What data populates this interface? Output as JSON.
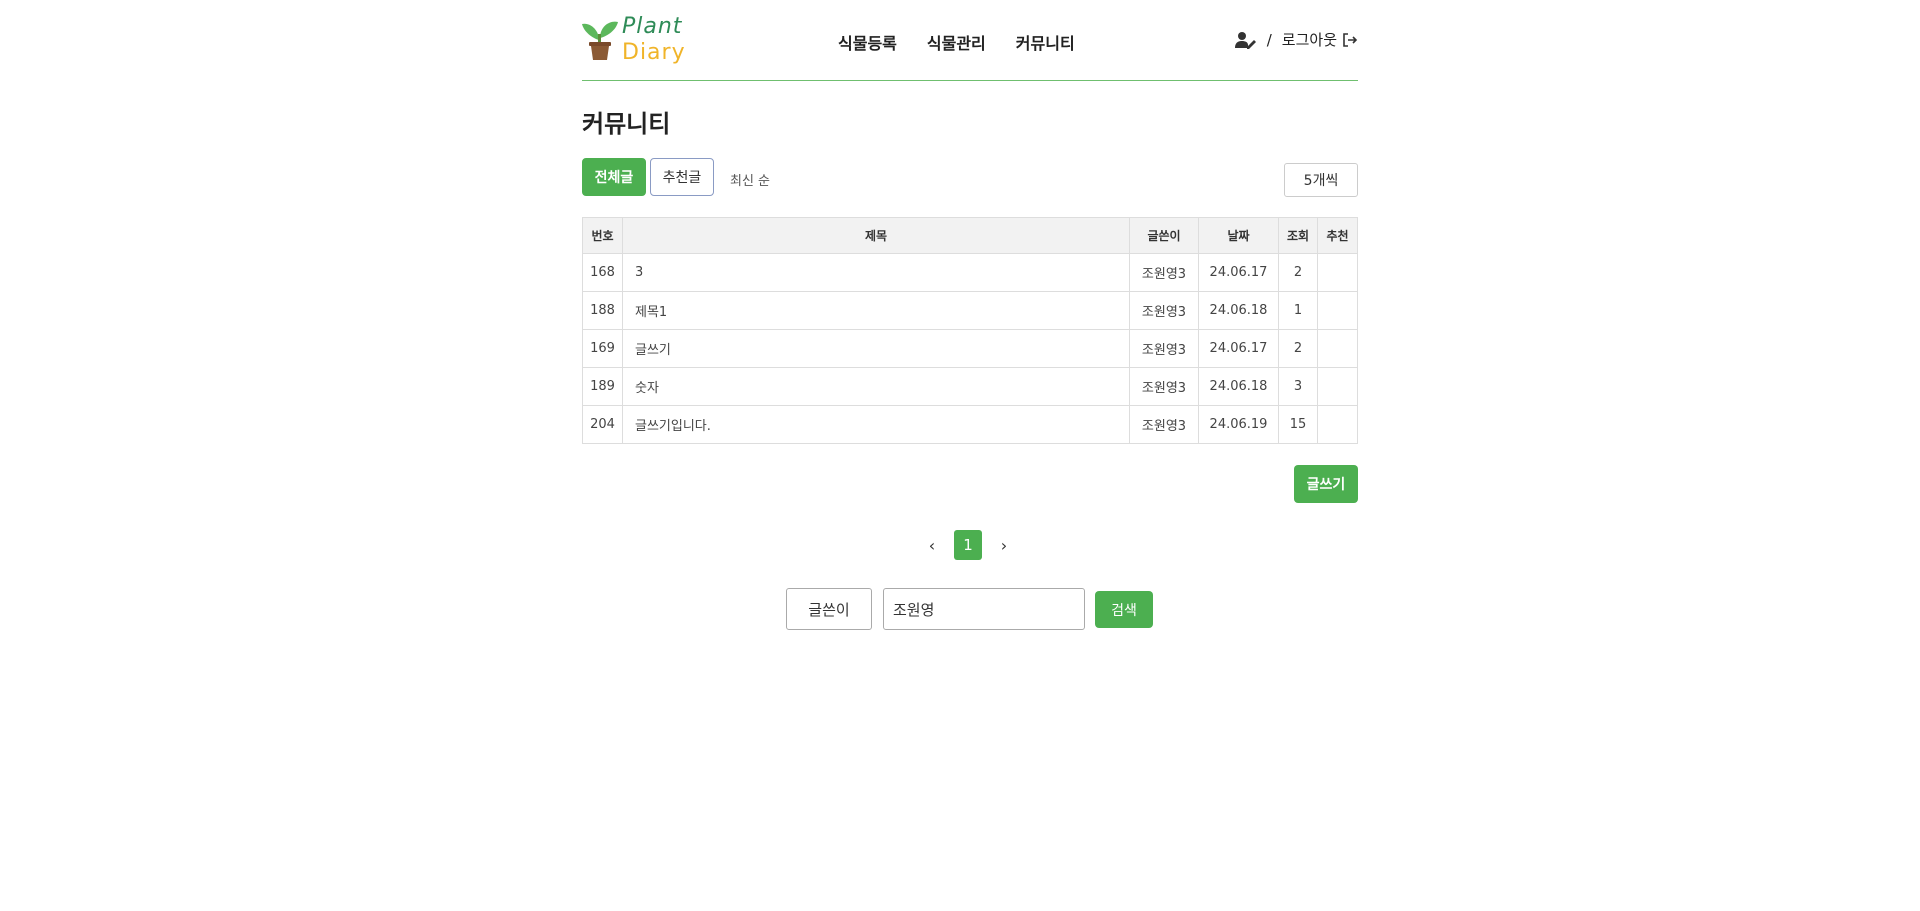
{
  "header": {
    "logo": {
      "line1": "Plant",
      "line2": "Diary"
    },
    "nav": [
      {
        "label": "식물등록"
      },
      {
        "label": "식물관리"
      },
      {
        "label": "커뮤니티"
      }
    ],
    "separator": "/",
    "logout_label": "로그아웃"
  },
  "page": {
    "title": "커뮤니티"
  },
  "filters": {
    "tab_all": "전체글",
    "tab_recommended": "추천글",
    "sort_label": "최신 순",
    "per_page": "5개씩"
  },
  "table": {
    "headers": [
      "번호",
      "제목",
      "글쓴이",
      "날짜",
      "조회",
      "추천"
    ],
    "rows": [
      {
        "no": "168",
        "title": "3",
        "author": "조원영3",
        "date": "24.06.17",
        "views": "2",
        "likes": ""
      },
      {
        "no": "188",
        "title": "제목1",
        "author": "조원영3",
        "date": "24.06.18",
        "views": "1",
        "likes": ""
      },
      {
        "no": "169",
        "title": "글쓰기",
        "author": "조원영3",
        "date": "24.06.17",
        "views": "2",
        "likes": ""
      },
      {
        "no": "189",
        "title": "숫자",
        "author": "조원영3",
        "date": "24.06.18",
        "views": "3",
        "likes": ""
      },
      {
        "no": "204",
        "title": "글쓰기입니다.",
        "author": "조원영3",
        "date": "24.06.19",
        "views": "15",
        "likes": ""
      }
    ]
  },
  "write_label": "글쓰기",
  "pagination": {
    "prev": "‹",
    "current": "1",
    "next": "›"
  },
  "search": {
    "type_label": "글쓴이",
    "value": "조원영",
    "button_label": "검색"
  },
  "colors": {
    "accent": "#4caf50",
    "header_line": "#6fbf6f"
  }
}
